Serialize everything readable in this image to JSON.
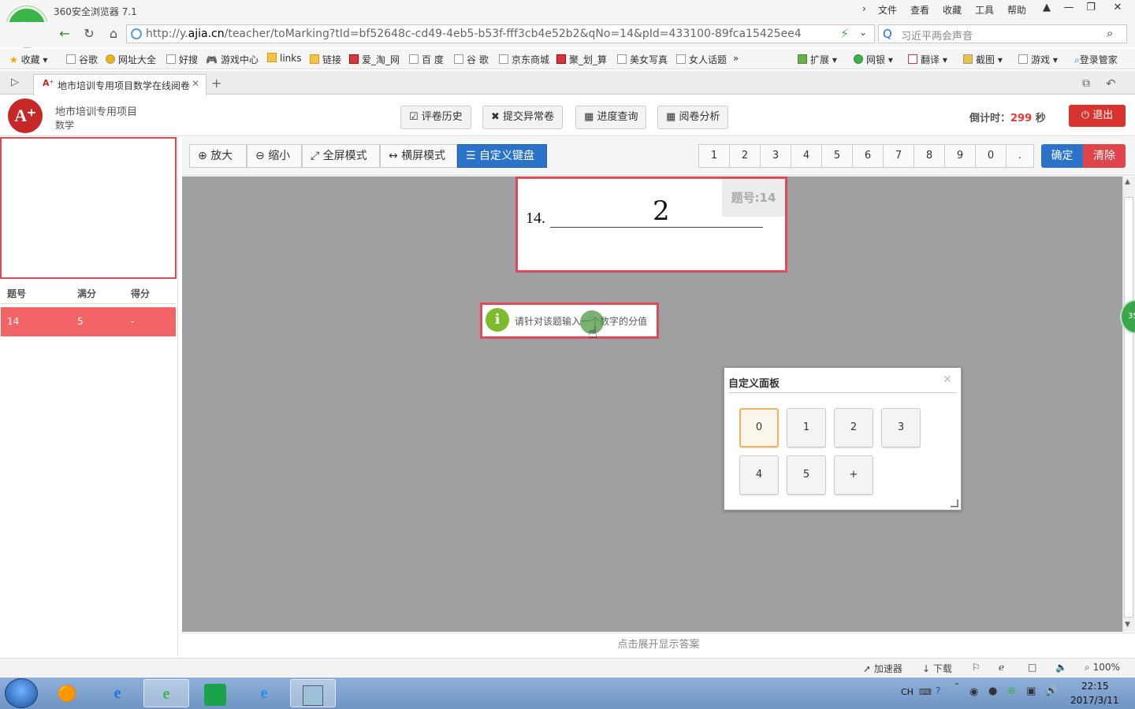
{
  "browser": {
    "app_title": "360安全浏览器 7.1",
    "menus": [
      "文件",
      "查看",
      "收藏",
      "工具",
      "帮助"
    ],
    "url_prefix": "http://y.",
    "url_domain": "ajia.cn",
    "url_rest": "/teacher/toMarking?tId=bf52648c-cd49-4eb5-b53f-fff3cb4e52b2&qNo=14&pId=433100-89fca15425ee4",
    "search_placeholder": "习近平两会声音",
    "bookmarks": [
      "收藏",
      "谷歌",
      "网址大全",
      "好搜",
      "游戏中心",
      "links",
      "链接",
      "爱_淘_网",
      "百 度",
      "谷 歌",
      "京东商城",
      "聚_划_算",
      "美女写真",
      "女人话题"
    ],
    "right_tools": [
      "扩展",
      "网银",
      "翻译",
      "截图",
      "游戏",
      "登录管家"
    ],
    "tab_title": "地市培训专用项目数学在线阅卷"
  },
  "header": {
    "project": "地市培训专用项目",
    "subject": "数学",
    "buttons": [
      "评卷历史",
      "提交异常卷",
      "进度查询",
      "阅卷分析"
    ],
    "countdown_label": "倒计时：",
    "countdown_value": "299",
    "countdown_unit": "秒",
    "exit_label": "退出"
  },
  "score_table": {
    "headers": [
      "题号",
      "满分",
      "得分"
    ],
    "rows": [
      {
        "qno": "14",
        "full": "5",
        "score": "-"
      }
    ]
  },
  "toolbar": {
    "zoom_in": "放大",
    "zoom_out": "缩小",
    "fullscreen": "全屏模式",
    "landscape": "横屏模式",
    "custom_keyboard": "自定义键盘",
    "keys": [
      "1",
      "2",
      "3",
      "4",
      "5",
      "6",
      "7",
      "8",
      "9",
      "0",
      "."
    ],
    "confirm": "确定",
    "clear": "清除"
  },
  "answer": {
    "badge": "题号:14",
    "question_number": "14.",
    "handwritten": "2"
  },
  "tip": {
    "text": "请针对该题输入一个数字的分值"
  },
  "side_badge": "35",
  "custom_panel": {
    "title": "自定义面板",
    "keys_row1": [
      "0",
      "1",
      "2",
      "3"
    ],
    "keys_row2": [
      "4",
      "5",
      "+"
    ]
  },
  "expand_label": "点击展开显示答案",
  "statusbar": {
    "accelerator": "加速器",
    "download": "下载",
    "zoom": "100%"
  },
  "taskbar": {
    "lang": "CH",
    "time": "22:15",
    "date": "2017/3/11"
  },
  "colors": {
    "accent_blue": "#2a73c9",
    "accent_red": "#e04a58",
    "exit_red": "#d9332f",
    "row_highlight": "#f26466"
  }
}
